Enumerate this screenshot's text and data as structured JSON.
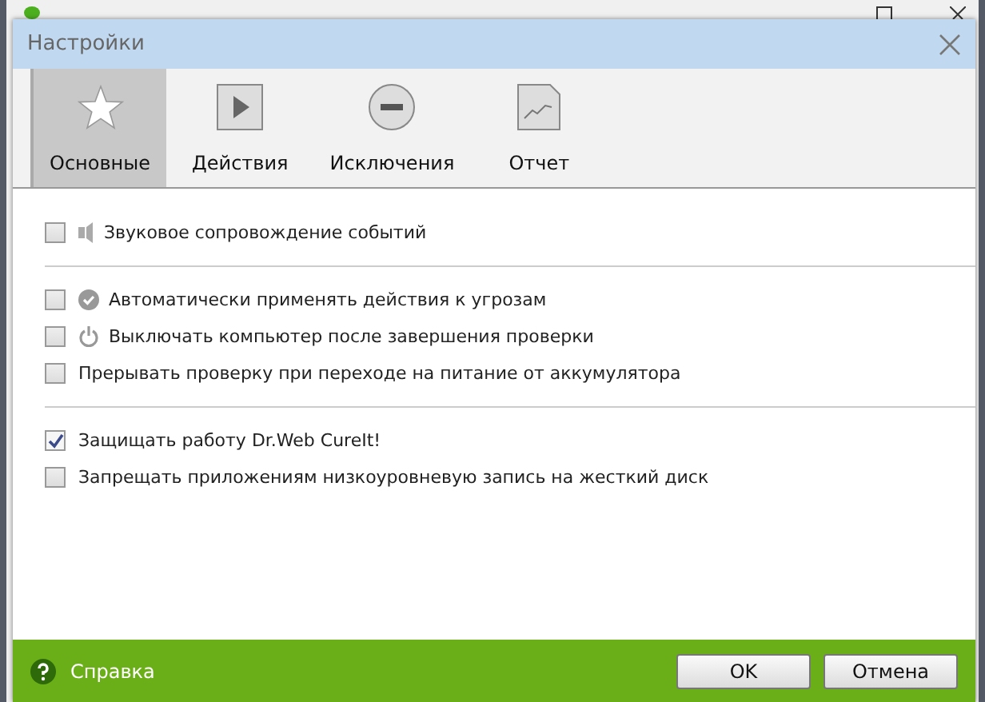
{
  "window": {
    "title": "Настройки"
  },
  "tabs": [
    {
      "label": "Основные",
      "kind": "star",
      "selected": true
    },
    {
      "label": "Действия",
      "kind": "play",
      "selected": false
    },
    {
      "label": "Исключения",
      "kind": "minus",
      "selected": false
    },
    {
      "label": "Отчет",
      "kind": "report",
      "selected": false
    }
  ],
  "groups": [
    [
      {
        "label": "Звуковое сопровождение событий",
        "kind": "sound",
        "checked": false
      }
    ],
    [
      {
        "label": "Автоматически применять действия к угрозам",
        "kind": "check",
        "checked": false
      },
      {
        "label": "Выключать компьютер после завершения проверки",
        "kind": "power",
        "checked": false
      },
      {
        "label": "Прерывать проверку при переходе на питание от аккумулятора",
        "kind": "plain",
        "checked": false
      }
    ],
    [
      {
        "label": "Защищать работу Dr.Web CureIt!",
        "kind": "plain",
        "checked": true
      },
      {
        "label": "Запрещать приложениям низкоуровневую запись на жесткий диск",
        "kind": "plain",
        "checked": false
      }
    ]
  ],
  "footer": {
    "help": "Справка",
    "buttons": [
      "OK",
      "Отмена"
    ]
  }
}
